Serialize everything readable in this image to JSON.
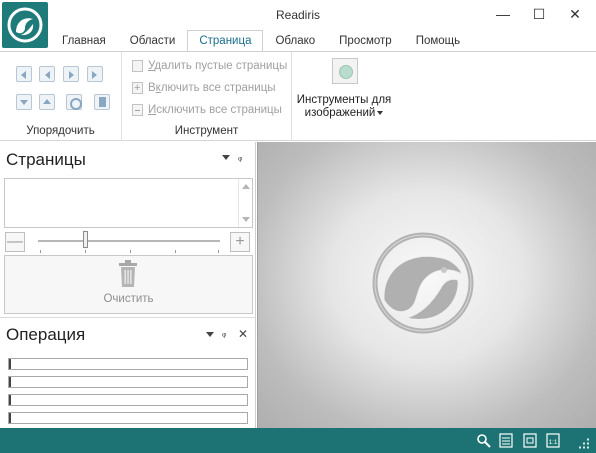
{
  "window": {
    "title": "Readiris",
    "minimize": "—",
    "maximize": "☐",
    "close": "✕"
  },
  "tabs": [
    "Главная",
    "Области",
    "Страница",
    "Облако",
    "Просмотр",
    "Помощь"
  ],
  "active_tab": "Страница",
  "ribbon": {
    "arrange": {
      "label": "Упорядочить"
    },
    "tools": {
      "label": "Инструмент",
      "delete_empty": {
        "u": "У",
        "rest": "далить пустые страницы"
      },
      "include_all": {
        "pre": "В",
        "u": "к",
        "rest": "лючить все страницы"
      },
      "exclude_all": {
        "u": "И",
        "rest": "сключить все страницы"
      }
    },
    "image_tools": {
      "line1": "Инструменты для",
      "line2": "изображений"
    }
  },
  "pages_panel": {
    "title": "Страницы",
    "zoom_out": "—",
    "zoom_in": "+",
    "clear_label": "Очистить"
  },
  "operation_panel": {
    "title": "Операция",
    "progress": [
      0,
      0,
      0,
      0
    ]
  },
  "icons": {
    "app": "readiris-logo-icon",
    "status": [
      "search-icon",
      "page-width-icon",
      "fit-page-icon",
      "actual-size-icon",
      "resize-grip-icon"
    ]
  },
  "status_icons": {
    "actual_size": "1:1"
  },
  "colors": {
    "brand": "#1f7a7a",
    "statusbar": "#1d7373",
    "active_tab_text": "#1a6e8e"
  }
}
